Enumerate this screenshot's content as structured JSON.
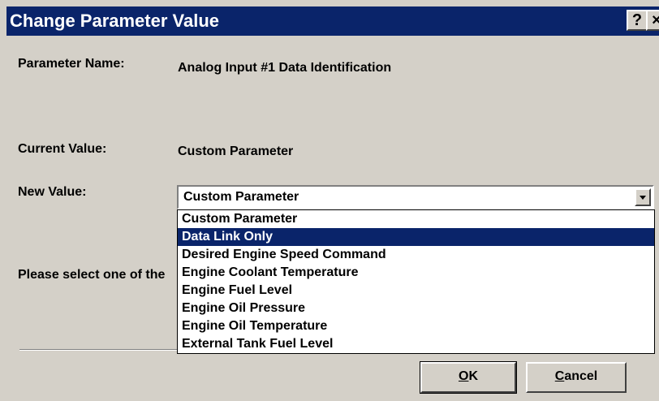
{
  "window": {
    "title": "Change Parameter Value",
    "help_glyph": "?",
    "close_glyph": "×"
  },
  "fields": {
    "parameter_name_label": "Parameter Name:",
    "parameter_name_value": "Analog Input #1 Data Identification",
    "current_value_label": "Current Value:",
    "current_value_value": "Custom Parameter",
    "new_value_label": "New Value:"
  },
  "combo": {
    "selected_value": "Custom Parameter",
    "options": [
      "Custom Parameter",
      "Data Link Only",
      "Desired Engine Speed Command",
      "Engine Coolant Temperature",
      "Engine Fuel Level",
      "Engine Oil Pressure",
      "Engine Oil Temperature",
      "External Tank Fuel Level"
    ],
    "highlighted_option": "Data Link Only"
  },
  "prompt_text": "Please select one of the",
  "buttons": {
    "ok_mnemonic": "O",
    "ok_rest": "K",
    "cancel_mnemonic": "C",
    "cancel_rest": "ancel"
  }
}
